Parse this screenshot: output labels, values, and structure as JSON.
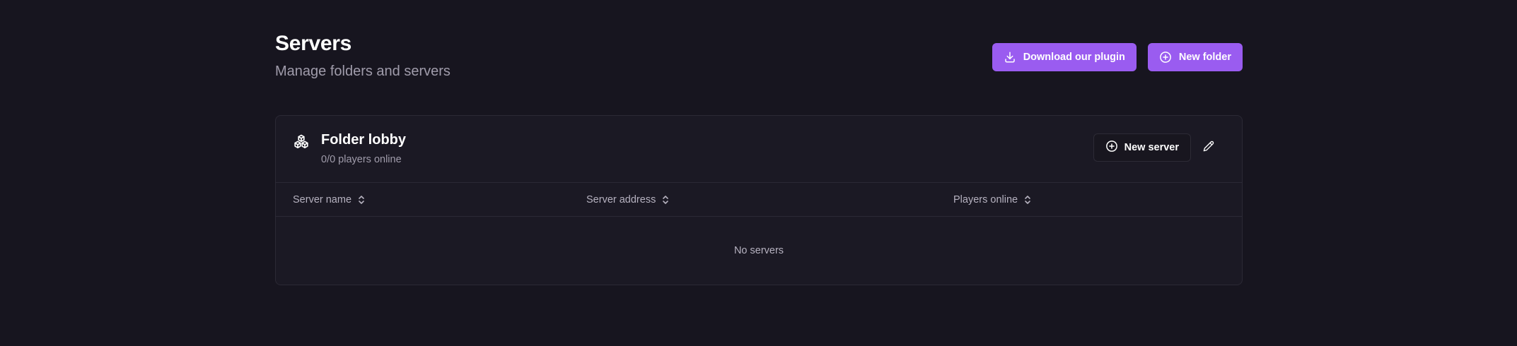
{
  "header": {
    "title": "Servers",
    "subtitle": "Manage folders and servers",
    "download_plugin_label": "Download our plugin",
    "new_folder_label": "New folder"
  },
  "folder": {
    "name": "Folder lobby",
    "players_online": "0/0 players online",
    "new_server_label": "New server",
    "icon": "boxes-icon",
    "edit_icon": "pencil-icon"
  },
  "table": {
    "columns": [
      "Server name",
      "Server address",
      "Players online"
    ],
    "rows": [],
    "empty_text": "No servers"
  },
  "colors": {
    "background": "#17151f",
    "card": "#1b1924",
    "accent": "#9a5cf0",
    "border": "#2b2935",
    "muted_text": "#a09cab"
  }
}
